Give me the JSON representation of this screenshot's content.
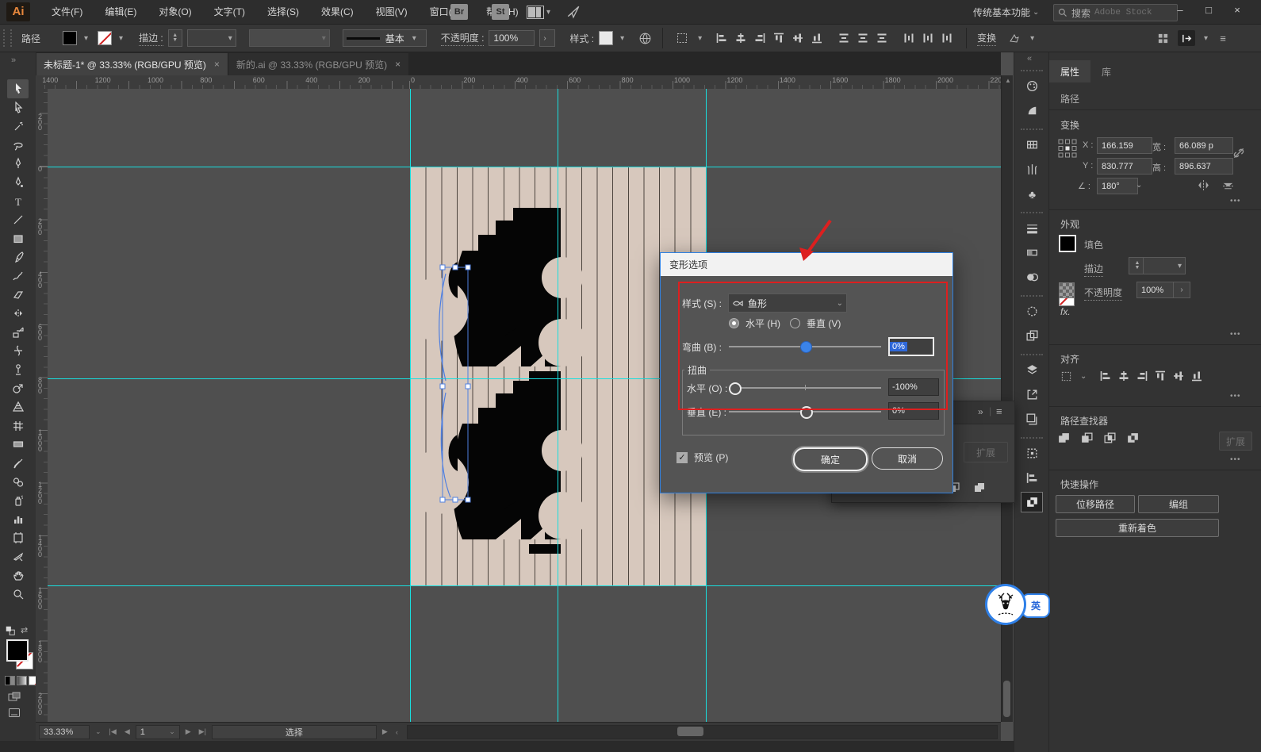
{
  "glyphs": {
    "chevron": "▾",
    "chevron_big": "⌄",
    "caret_up": "▴",
    "gt": "›",
    "lt": "‹",
    "min": "–",
    "max": "□",
    "close": "×",
    "play_r": "▶",
    "play_l": "◀",
    "bar": "|",
    "more": "•••",
    "collapse_r": "»",
    "collapse_l": "«",
    "menu": "≡",
    "check": "✓",
    "up_sm": "▲",
    "down_sm": "▼"
  },
  "menubar": {
    "logo": "Ai",
    "items": [
      "文件(F)",
      "编辑(E)",
      "对象(O)",
      "文字(T)",
      "选择(S)",
      "效果(C)",
      "视图(V)",
      "窗口(W)",
      "帮助(H)"
    ],
    "br": "Br",
    "st": "St",
    "workspace": "传统基本功能",
    "search_prefix": "搜索",
    "search_placeholder": "Adobe Stock"
  },
  "controlbar": {
    "context": "路径",
    "stroke_label": "描边 :",
    "brush_style": "基本",
    "opacity_label": "不透明度 :",
    "opacity_value": "100%",
    "style_label": "样式 :",
    "transform_label": "变换",
    "align_icons": [
      "align-left",
      "align-center-h",
      "align-right",
      "align-top",
      "align-middle-v",
      "align-bottom",
      "dist-v-top",
      "dist-v-center",
      "dist-v-bottom",
      "dist-h-left",
      "dist-h-center",
      "dist-h-right"
    ]
  },
  "tabs": [
    {
      "title": "未标题-1* @ 33.33% (RGB/GPU 预览)"
    },
    {
      "title": "新的.ai @ 33.33% (RGB/GPU 预览)"
    }
  ],
  "rulers": {
    "top": [
      "1400",
      "1200",
      "1000",
      "800",
      "600",
      "400",
      "200",
      "0",
      "200",
      "400",
      "600",
      "800",
      "1000",
      "1200",
      "1400",
      "1600",
      "1800",
      "2000",
      "2200"
    ],
    "left": [
      "200",
      "0",
      "200",
      "400",
      "600",
      "800",
      "1000",
      "1200",
      "1400",
      "1600",
      "1800",
      "2000"
    ]
  },
  "toolbar": {
    "tools": [
      "selection-tool",
      "direct-selection-tool",
      "magic-wand-tool",
      "lasso-tool",
      "pen-tool",
      "curvature-tool",
      "type-tool",
      "line-segment-tool",
      "rectangle-tool",
      "paintbrush-tool",
      "shaper-tool",
      "eraser-tool",
      "reflect-tool",
      "scale-tool",
      "width-tool",
      "puppet-warp-tool",
      "shape-builder-tool",
      "perspective-grid-tool",
      "mesh-tool",
      "gradient-tool",
      "eyedropper-tool",
      "blend-tool",
      "symbol-sprayer-tool",
      "column-graph-tool",
      "artboard-tool",
      "slice-tool",
      "hand-tool",
      "zoom-tool"
    ]
  },
  "dock": {
    "icons": [
      "color",
      "color-guide",
      "swatches",
      "brushes",
      "symbols",
      "stroke",
      "gradient",
      "transparency",
      "appearance",
      "graphic-styles",
      "layers",
      "export",
      "artboards",
      "transform",
      "align",
      "pathfinder"
    ]
  },
  "dialog": {
    "title": "变形选项",
    "style_label": "样式 (S) :",
    "style_value": "鱼形",
    "radio_h": "水平 (H)",
    "radio_v": "垂直 (V)",
    "bend_label": "弯曲 (B) :",
    "bend_value": "0%",
    "distort_label": "扭曲",
    "h_label": "水平 (O) :",
    "h_value": "-100%",
    "v_label": "垂直 (E) :",
    "v_value": "0%",
    "preview_label": "预览 (P)",
    "ok_label": "确定",
    "cancel_label": "取消"
  },
  "float_panel": {
    "expand_label": "扩展"
  },
  "properties": {
    "tab_properties": "属性",
    "tab_libraries": "库",
    "context_label": "路径",
    "transform": {
      "title": "变换",
      "x_label": "X :",
      "x_value": "166.159",
      "y_label": "Y :",
      "y_value": "830.777",
      "w_label": "宽 :",
      "w_value": "66.089 p",
      "h_label": "高 :",
      "h_value": "896.637",
      "angle_value": "180°"
    },
    "appearance": {
      "title": "外观",
      "fill_label": "填色",
      "stroke_label": "描边",
      "opacity_label": "不透明度",
      "opacity_value": "100%",
      "fx_label": "fx."
    },
    "align": {
      "title": "对齐"
    },
    "pathfinder": {
      "title": "路径查找器",
      "icons": [
        "unite",
        "minus-front",
        "intersect",
        "exclude"
      ],
      "expand_label": "扩展"
    },
    "quick_actions": {
      "title": "快速操作",
      "offset_path": "位移路径",
      "group": "编组",
      "recolor": "重新着色"
    }
  },
  "statusbar": {
    "zoom": "33.33%",
    "artboard": "1",
    "status": "选择"
  },
  "watermark": {
    "lang_badge": "英"
  },
  "colors": {
    "accent_blue": "#3b83e8",
    "guide_cyan": "#19dede",
    "annotation_red": "#dd1f1f",
    "artboard_beige": "#d7c8bd",
    "selection_blue": "#4f7fe0"
  }
}
